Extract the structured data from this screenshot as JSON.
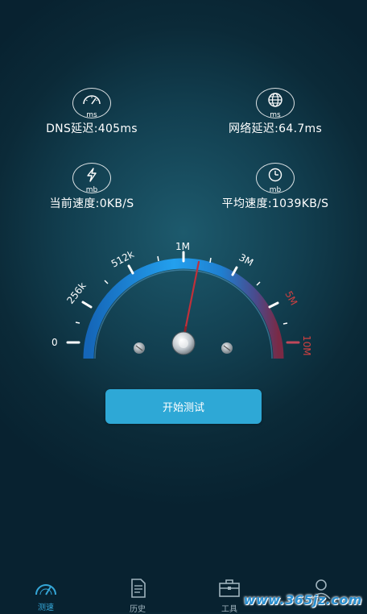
{
  "stats": {
    "dns": {
      "unit": "ms",
      "label": "DNS延迟:405ms",
      "icon": "speedometer-icon"
    },
    "network": {
      "unit": "ms",
      "label": "网络延迟:64.7ms",
      "icon": "globe-icon"
    },
    "current": {
      "unit": "mb",
      "label": "当前速度:0KB/S",
      "icon": "lightning-icon"
    },
    "average": {
      "unit": "mb",
      "label": "平均速度:1039KB/S",
      "icon": "clock-icon"
    }
  },
  "gauge": {
    "ticks": [
      "0",
      "256k",
      "512k",
      "1M",
      "3M",
      "5M",
      "10M"
    ],
    "needle_value": "1M",
    "colors": {
      "arc_blue": "#1c8fe0",
      "arc_red": "#7a2a45",
      "needle": "#c0303a",
      "red_label": "#d04040"
    }
  },
  "start_button": {
    "label": "开始测试"
  },
  "tabs": [
    {
      "label": "测速",
      "icon": "speedometer-tab-icon",
      "active": true
    },
    {
      "label": "历史",
      "icon": "document-icon",
      "active": false
    },
    {
      "label": "工具",
      "icon": "toolbox-icon",
      "active": false
    },
    {
      "label": "",
      "icon": "user-icon",
      "active": false
    }
  ],
  "watermark": "www.365jz.com"
}
